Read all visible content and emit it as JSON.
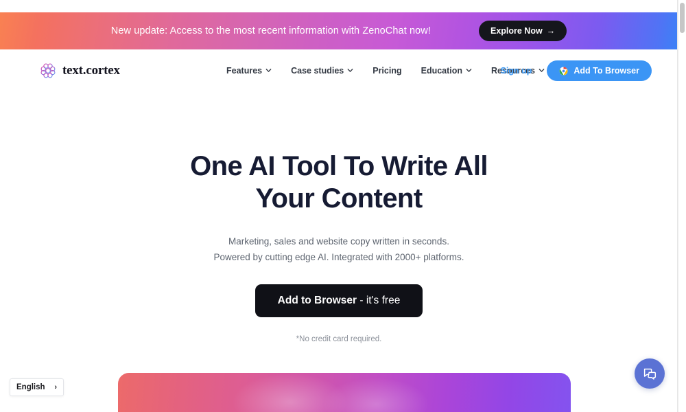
{
  "banner": {
    "message": "New update: Access to the most recent information with ZenoChat now!",
    "button_label": "Explore Now",
    "button_arrow": "→",
    "gradient_from": "#f98152",
    "gradient_mid": "#c75ad6",
    "gradient_to": "#3b82f6",
    "button_bg": "#15161c"
  },
  "nav": {
    "brand": "text.cortex",
    "brand_icon": "brain-circles-logo-icon",
    "links": [
      {
        "label": "Features",
        "has_dropdown": true,
        "icon": "chevron-down-icon"
      },
      {
        "label": "Case studies",
        "has_dropdown": true,
        "icon": "chevron-down-icon"
      },
      {
        "label": "Pricing",
        "has_dropdown": false,
        "icon": ""
      },
      {
        "label": "Education",
        "has_dropdown": true,
        "icon": "chevron-down-icon"
      },
      {
        "label": "Resources",
        "has_dropdown": true,
        "icon": "chevron-down-icon"
      }
    ],
    "signup_label": "Sign up",
    "signup_color": "#3e9af4",
    "cta_label": "Add To Browser",
    "cta_icon": "chrome-icon",
    "cta_bg": "#3b95f5"
  },
  "hero": {
    "headline": "One AI Tool To Write All Your Content",
    "headline_color": "#161b33",
    "subhead_line1": "Marketing, sales and website copy written in seconds.",
    "subhead_line2": "Powered by cutting edge AI. Integrated with 2000+ platforms.",
    "cta_bold": "Add to Browser",
    "cta_rest": " - it's free",
    "cta_bg": "#101117",
    "note": "*No credit card required."
  },
  "showcase": {
    "gradient_from": "#ec6a6a",
    "gradient_mid": "#c04ec6",
    "gradient_to": "#8453ef"
  },
  "language_selector": {
    "label": "English",
    "arrow": "›",
    "icon": "chevron-right-icon"
  },
  "chat_widget": {
    "icon": "chat-bubbles-icon",
    "color": "#5b72d4"
  },
  "scrollbar": {
    "icon": "vertical-scrollbar"
  }
}
